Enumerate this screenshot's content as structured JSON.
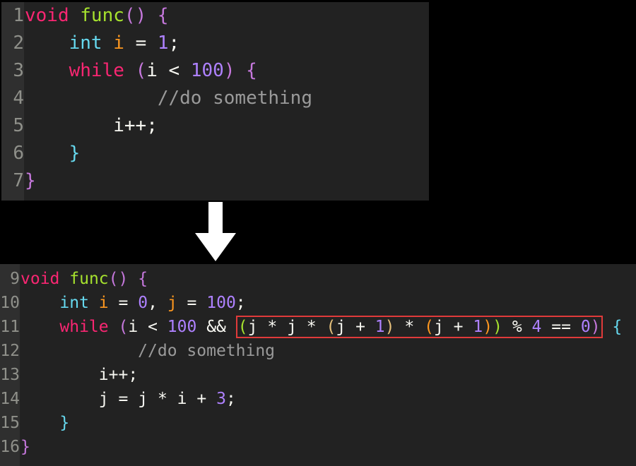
{
  "before": {
    "line_numbers": [
      "1",
      "2",
      "3",
      "4",
      "5",
      "6",
      "7"
    ],
    "l1": {
      "void": "void",
      "name": "func",
      "open": "(",
      "close": ")",
      "brace": "{"
    },
    "l2": {
      "int": "int",
      "i": "i",
      "eq": "=",
      "one": "1",
      "semi": ";"
    },
    "l3": {
      "while": "while",
      "open": "(",
      "i": "i",
      "lt": "<",
      "hundred": "100",
      "close": ")",
      "brace": "{"
    },
    "l4": {
      "comment": "//do something"
    },
    "l5": {
      "inc": "i++;"
    },
    "l6": {
      "brace": "}"
    },
    "l7": {
      "brace": "}"
    }
  },
  "after": {
    "line_numbers": [
      "9",
      "10",
      "11",
      "12",
      "13",
      "14",
      "15",
      "16"
    ],
    "l9": {
      "void": "void",
      "name": "func",
      "open": "(",
      "close": ")",
      "brace": "{"
    },
    "l10": {
      "int": "int",
      "i": "i",
      "eq1": "=",
      "zero": "0",
      "comma": ",",
      "j": "j",
      "eq2": "=",
      "hundred": "100",
      "semi": ";"
    },
    "l11": {
      "while": "while",
      "open": "(",
      "i": "i",
      "lt": "<",
      "hundred": "100",
      "and": "&&",
      "g_open": "(",
      "j1": "j",
      "m1": "*",
      "j2": "j",
      "m2": "*",
      "pa_open": "(",
      "j3": "j",
      "plus1": "+",
      "one1": "1",
      "pa_close": ")",
      "m3": "*",
      "pb_open": "(",
      "j4": "j",
      "plus2": "+",
      "one2": "1",
      "pb_close": ")",
      "g_close": ")",
      "mod": "%",
      "four": "4",
      "eqeq": "==",
      "zero": "0",
      "close": ")",
      "brace": "{"
    },
    "l12": {
      "comment": "//do something"
    },
    "l13": {
      "inc": "i++;"
    },
    "l14": {
      "j": "j",
      "eq": "=",
      "j2": "j",
      "mul": "*",
      "i": "i",
      "plus": "+",
      "three": "3",
      "semi": ";"
    },
    "l15": {
      "brace": "}"
    },
    "l16": {
      "brace": "}"
    }
  },
  "colors": {
    "editor_bg": "#222222",
    "gutter_bg": "#2f2f2f",
    "highlight_box": "#e03a3a",
    "arrow": "#ffffff"
  }
}
